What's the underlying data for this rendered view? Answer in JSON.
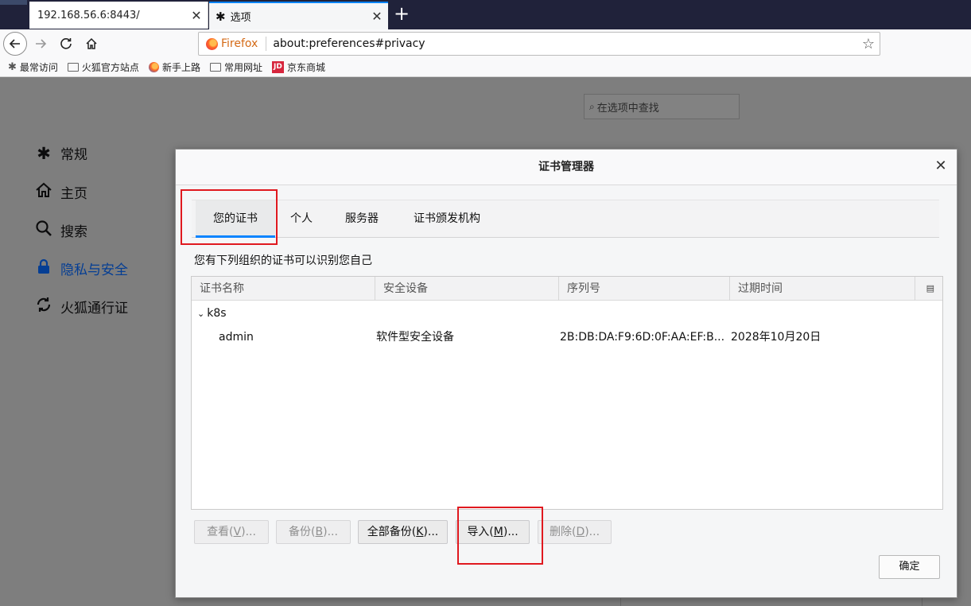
{
  "browser": {
    "tabs": [
      {
        "label": "192.168.56.6:8443/",
        "active": false
      },
      {
        "label": "选项",
        "active": true
      }
    ],
    "close_glyph": "✕",
    "new_tab_glyph": "+",
    "url_identity": "Firefox",
    "url": "about:preferences#privacy",
    "bookmarks": [
      {
        "label": "最常访问",
        "icon": "gear-icon"
      },
      {
        "label": "火狐官方站点",
        "icon": "folder-icon"
      },
      {
        "label": "新手上路",
        "icon": "firefox-icon"
      },
      {
        "label": "常用网址",
        "icon": "folder-icon"
      },
      {
        "label": "京东商城",
        "icon": "jd-icon"
      }
    ],
    "jd_text": "JD"
  },
  "prefs": {
    "search_placeholder": "在选项中查找",
    "sidebar": [
      {
        "label": "常规",
        "icon": "gear-icon"
      },
      {
        "label": "主页",
        "icon": "home-icon"
      },
      {
        "label": "搜索",
        "icon": "search-icon"
      },
      {
        "label": "隐私与安全",
        "icon": "lock-icon",
        "selected": true
      },
      {
        "label": "火狐通行证",
        "icon": "sync-icon"
      }
    ]
  },
  "dialog": {
    "title": "证书管理器",
    "tabs": [
      "您的证书",
      "个人",
      "服务器",
      "证书颁发机构"
    ],
    "description": "您有下列组织的证书可以识别您自己",
    "columns": [
      "证书名称",
      "安全设备",
      "序列号",
      "过期时间"
    ],
    "group": "k8s",
    "rows": [
      {
        "name": "admin",
        "device": "软件型安全设备",
        "serial": "2B:DB:DA:F9:6D:0F:AA:EF:B...",
        "expiry": "2028年10月20日"
      }
    ],
    "buttons": {
      "view": {
        "text": "查看(",
        "key": "V",
        "tail": ")..."
      },
      "backup": {
        "text": "备份(",
        "key": "B",
        "tail": ")..."
      },
      "backup_all": {
        "text": "全部备份(",
        "key": "K",
        "tail": ")..."
      },
      "import": {
        "text": "导入(",
        "key": "M",
        "tail": ")..."
      },
      "delete": {
        "text": "删除(",
        "key": "D",
        "tail": ")..."
      }
    },
    "ok_label": "确定"
  },
  "colors": {
    "accent": "#0a84ff",
    "highlight_box": "#e0191f",
    "selected_sidebar": "#053e94"
  }
}
